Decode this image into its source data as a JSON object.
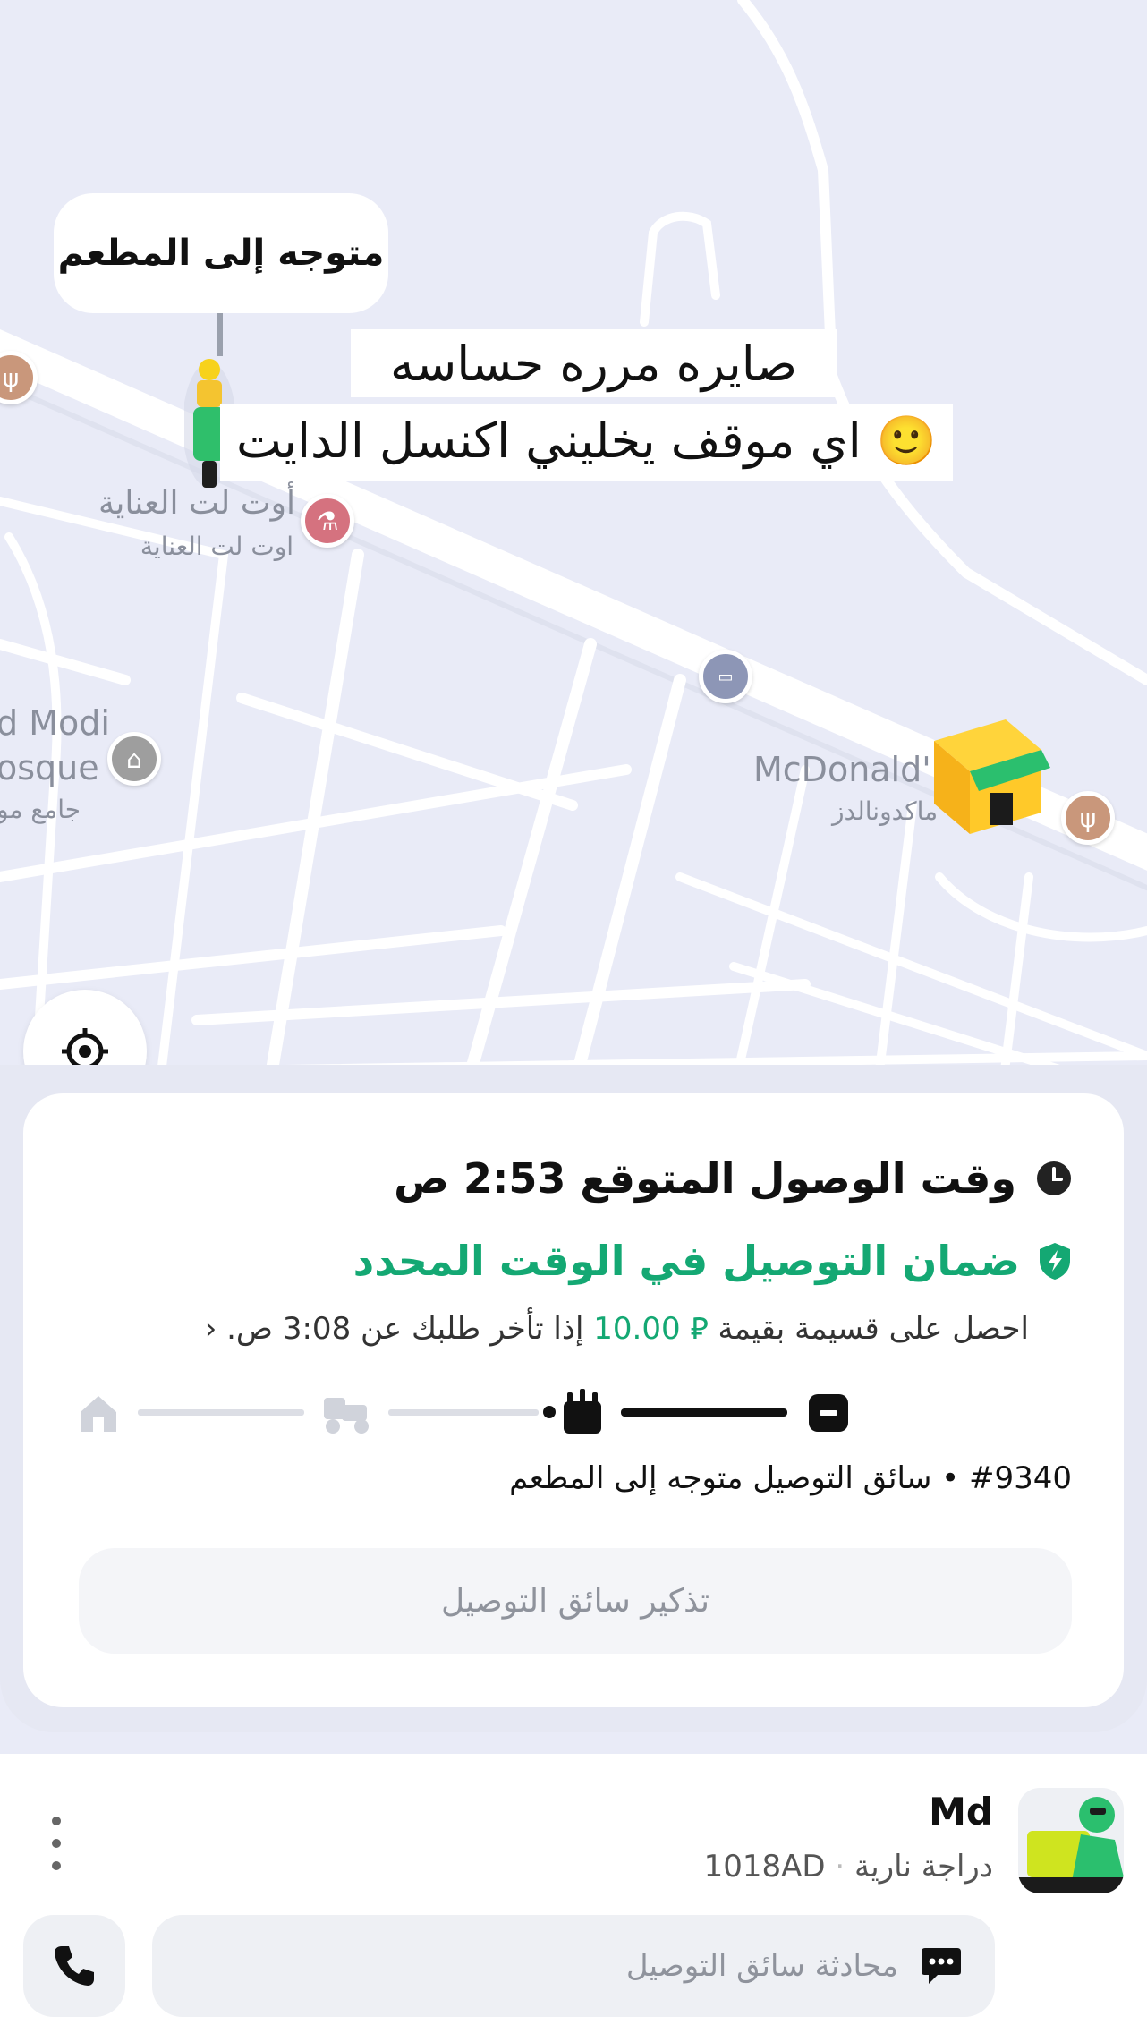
{
  "map": {
    "heading_bubble": "متوجه إلى المطعم",
    "story_caption_line1": "صايره مرره حساسه",
    "story_caption_line2": "اي موقف يخليني اكنسل الدايت 🙂",
    "pois": {
      "outlet_name": "أوت لت العناية",
      "outlet_name_sub": "اوت لت العناية",
      "mosque_name_en_1": "d Modi",
      "mosque_name_en_2": "osque",
      "mosque_name_ar": "جامع مو",
      "mcdonalds_en": "McDonald'",
      "mcdonalds_ar": "ماكدونالدز"
    }
  },
  "order_card": {
    "eta_text": "وقت الوصول المتوقع 2:53 ص",
    "guarantee_title": "ضمان التوصيل في الوقت المحدد",
    "guarantee_sub_prefix": "احصل على قسيمة بقيمة",
    "guarantee_amount": "10.00",
    "currency_symbol": "⃁",
    "guarantee_sub_suffix": "إذا تأخر طلبك عن 3:08 ص.",
    "chevron": "‹",
    "order_status": "#9340 • سائق التوصيل متوجه إلى المطعم",
    "remind_button": "تذكير سائق التوصيل",
    "progress_steps": [
      "order",
      "restaurant",
      "scooter",
      "home"
    ],
    "progress_active_step": "restaurant"
  },
  "driver": {
    "name": "Md",
    "vehicle": "دراجة نارية",
    "plate": "1018AD",
    "chat_placeholder": "محادثة سائق التوصيل"
  },
  "colors": {
    "accent_green": "#14a873",
    "map_bg": "#e9ebf7",
    "dark": "#111111"
  },
  "icons": [
    "clock-icon",
    "shield-bolt-icon",
    "receipt-icon",
    "restaurant-icon",
    "scooter-icon",
    "home-icon",
    "locate-icon",
    "phone-icon",
    "chat-icon",
    "kebab-icon",
    "fork-knife-icon",
    "atm-icon",
    "mosque-icon",
    "pharmacy-icon"
  ]
}
